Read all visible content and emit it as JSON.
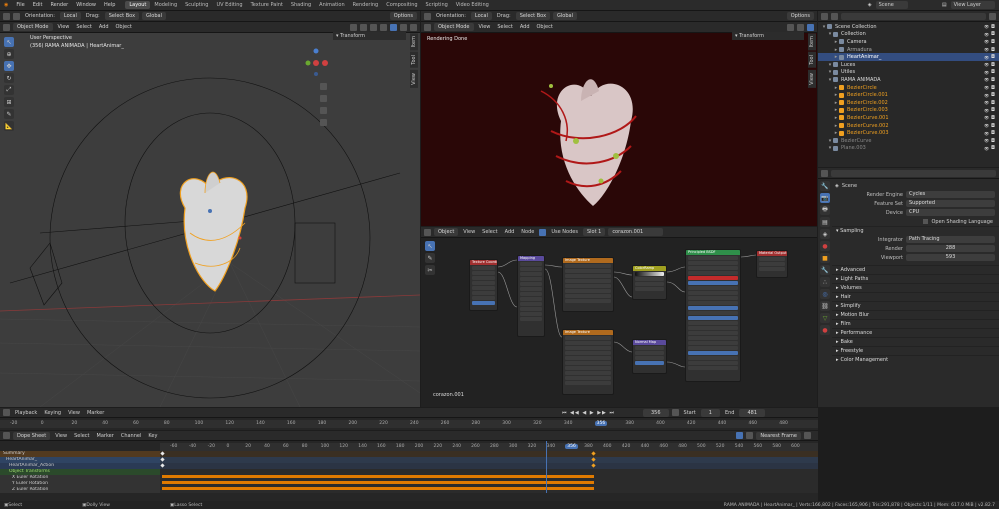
{
  "colors": {
    "accent": "#4772b3",
    "active_object": "#f0a020",
    "keyframe_bar": "#e07a00",
    "render_bg": "#2a0707",
    "node_editor_bg": "#222222"
  },
  "topbar": {
    "menus": [
      "File",
      "Edit",
      "Render",
      "Window",
      "Help"
    ],
    "tabs": [
      "Layout",
      "Modeling",
      "Sculpting",
      "UV Editing",
      "Texture Paint",
      "Shading",
      "Animation",
      "Rendering",
      "Compositing",
      "Scripting",
      "Video Editing"
    ],
    "active_tab": "Layout",
    "scene": "Scene",
    "view_layer": "View Layer"
  },
  "viewport3d": {
    "header_top": {
      "orientation_label": "Orientation:",
      "orientation": "Local",
      "drag_label": "Drag:",
      "drag": "Select Box",
      "transform": "Global",
      "options": "Options"
    },
    "header2": {
      "mode": "Object Mode",
      "menus": [
        "View",
        "Select",
        "Add",
        "Object"
      ]
    },
    "overlay_title": "User Perspective",
    "overlay_sub": "(356) RAMA ANIMADA | HeartAnimar_",
    "transform_panel": "Transform",
    "side_tabs": [
      "Item",
      "Tool",
      "View"
    ]
  },
  "render_view": {
    "header_top": {
      "orientation_label": "Orientation:",
      "orientation": "Local",
      "drag_label": "Drag:",
      "drag": "Select Box",
      "transform": "Global",
      "options": "Options"
    },
    "header2": {
      "mode": "Object Mode",
      "menus": [
        "View",
        "Select",
        "Add",
        "Object"
      ]
    },
    "status": "Rendering Done",
    "transform_panel": "Transform",
    "side_tabs": [
      "Item",
      "Tool",
      "View"
    ]
  },
  "node_editor": {
    "header": {
      "type": "Object",
      "menus": [
        "View",
        "Select",
        "Add",
        "Node"
      ],
      "use_nodes": "Use Nodes",
      "slot": "Slot 1",
      "material": "corazon.001"
    },
    "footer_label": "corazon.001",
    "nodes": [
      {
        "title": "Texture Coordinate",
        "color": "#a13030"
      },
      {
        "title": "Mapping",
        "color": "#5a4a9c"
      },
      {
        "title": "Image Texture",
        "color": "#b06a1e"
      },
      {
        "title": "ColorRamp",
        "color": "#a0a020"
      },
      {
        "title": "Principled BSDF",
        "color": "#2f8f4a"
      },
      {
        "title": "Material Output",
        "color": "#a13030"
      },
      {
        "title": "Image Texture",
        "color": "#b06a1e"
      },
      {
        "title": "Normal Map",
        "color": "#5a4a9c"
      }
    ]
  },
  "outliner": {
    "search_placeholder": "",
    "items": [
      {
        "label": "Scene Collection",
        "indent": 0,
        "color": "#dddddd"
      },
      {
        "label": "Collection",
        "indent": 1,
        "color": "#dddddd"
      },
      {
        "label": "Camera",
        "indent": 2,
        "color": "#dddddd"
      },
      {
        "label": "Armadura",
        "indent": 2,
        "color": "#aaaaaa"
      },
      {
        "label": "HeartAnimar_",
        "indent": 2,
        "color": "#ffffff",
        "selected": true
      },
      {
        "label": "Luces",
        "indent": 1,
        "color": "#dddddd"
      },
      {
        "label": "Utiles",
        "indent": 1,
        "color": "#dddddd"
      },
      {
        "label": "RAMA ANIMADA",
        "indent": 1,
        "color": "#dddddd"
      },
      {
        "label": "BezierCircle",
        "indent": 2,
        "color": "#f0a020"
      },
      {
        "label": "BezierCircle.001",
        "indent": 2,
        "color": "#f0a020"
      },
      {
        "label": "BezierCircle.002",
        "indent": 2,
        "color": "#f0a020"
      },
      {
        "label": "BezierCircle.003",
        "indent": 2,
        "color": "#f0a020"
      },
      {
        "label": "BezierCurve.001",
        "indent": 2,
        "color": "#f0a020"
      },
      {
        "label": "BezierCurve.002",
        "indent": 2,
        "color": "#f0a020"
      },
      {
        "label": "BezierCurve.003",
        "indent": 2,
        "color": "#f0a020"
      },
      {
        "label": "BezierCurve",
        "indent": 1,
        "color": "#888888"
      },
      {
        "label": "Plane.003",
        "indent": 1,
        "color": "#888888"
      }
    ]
  },
  "properties": {
    "scene_label": "Scene",
    "rows": [
      {
        "label": "Render Engine",
        "value": "Cycles"
      },
      {
        "label": "Feature Set",
        "value": "Supported"
      },
      {
        "label": "Device",
        "value": "CPU"
      }
    ],
    "osl": "Open Shading Language",
    "sampling": "Sampling",
    "integrator_label": "Integrator",
    "integrator": "Path Tracing",
    "render_label": "Render",
    "render_value": "288",
    "viewport_label": "Viewport",
    "viewport_value": "593",
    "sections": [
      "Advanced",
      "Light Paths",
      "Volumes",
      "Hair",
      "Simplify",
      "Motion Blur",
      "Film",
      "Performance",
      "Bake",
      "Freestyle",
      "Color Management"
    ]
  },
  "timeline": {
    "menus": [
      "Playback",
      "Keying",
      "View",
      "Marker"
    ],
    "current_frame": "356",
    "start_label": "Start",
    "start": "1",
    "end_label": "End",
    "end": "481",
    "ruler": [
      "-20",
      "0",
      "20",
      "40",
      "60",
      "80",
      "100",
      "120",
      "140",
      "160",
      "180",
      "200",
      "220",
      "240",
      "260",
      "280",
      "300",
      "320",
      "340",
      "356",
      "380",
      "400",
      "420",
      "440",
      "460",
      "480"
    ]
  },
  "dopesheet": {
    "mode": "Dope Sheet",
    "menus": [
      "View",
      "Select",
      "Marker",
      "Channel",
      "Key"
    ],
    "snap": "Nearest Frame",
    "current_frame": "356",
    "ruler": [
      "-60",
      "-40",
      "-20",
      "0",
      "20",
      "40",
      "60",
      "80",
      "100",
      "120",
      "140",
      "160",
      "180",
      "200",
      "220",
      "240",
      "260",
      "280",
      "300",
      "320",
      "340",
      "356",
      "380",
      "400",
      "420",
      "440",
      "460",
      "480",
      "500",
      "520",
      "540",
      "560",
      "580",
      "600"
    ],
    "channels": [
      "Summary",
      "HeartAnimar_",
      "HeartAnimar_Action",
      "Object Transforms",
      "X Euler Rotation",
      "Y Euler Rotation",
      "Z Euler Rotation"
    ]
  },
  "statusbar": {
    "left": [
      "Select",
      "Dolly View",
      "Lasso Select"
    ],
    "right": "RAMA ANIMADA | HeartAnimar_ | Verts:166,802 | Faces:165,906 | Tris:291,878 | Objects:1/11 | Mem: 617.0 MiB | v2.82.7"
  }
}
